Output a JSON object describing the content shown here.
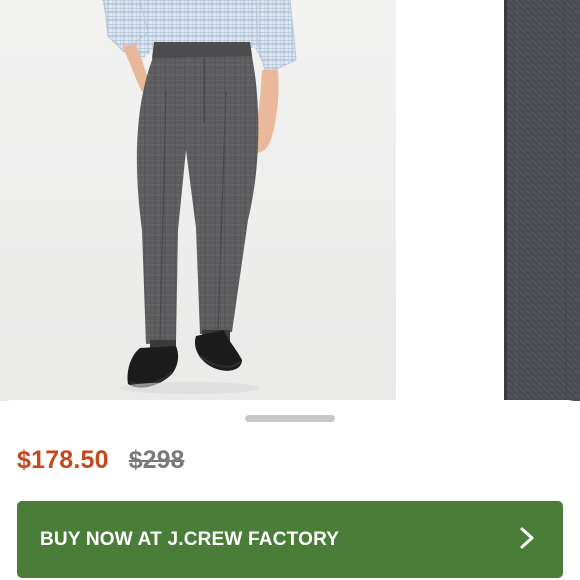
{
  "product": {
    "image_alt": "Model wearing slim-fit charcoal glen plaid dress pants with loafers",
    "next_image_alt": "Close-up of charcoal suiting fabric"
  },
  "pricing": {
    "sale_price": "$178.50",
    "original_price": "$298",
    "sale_color": "#c4491c",
    "original_color": "#7a7a7a"
  },
  "cta": {
    "label": "BUY NOW AT J.CREW FACTORY",
    "icon": "chevron-right-icon",
    "color": "#4a7d37"
  }
}
